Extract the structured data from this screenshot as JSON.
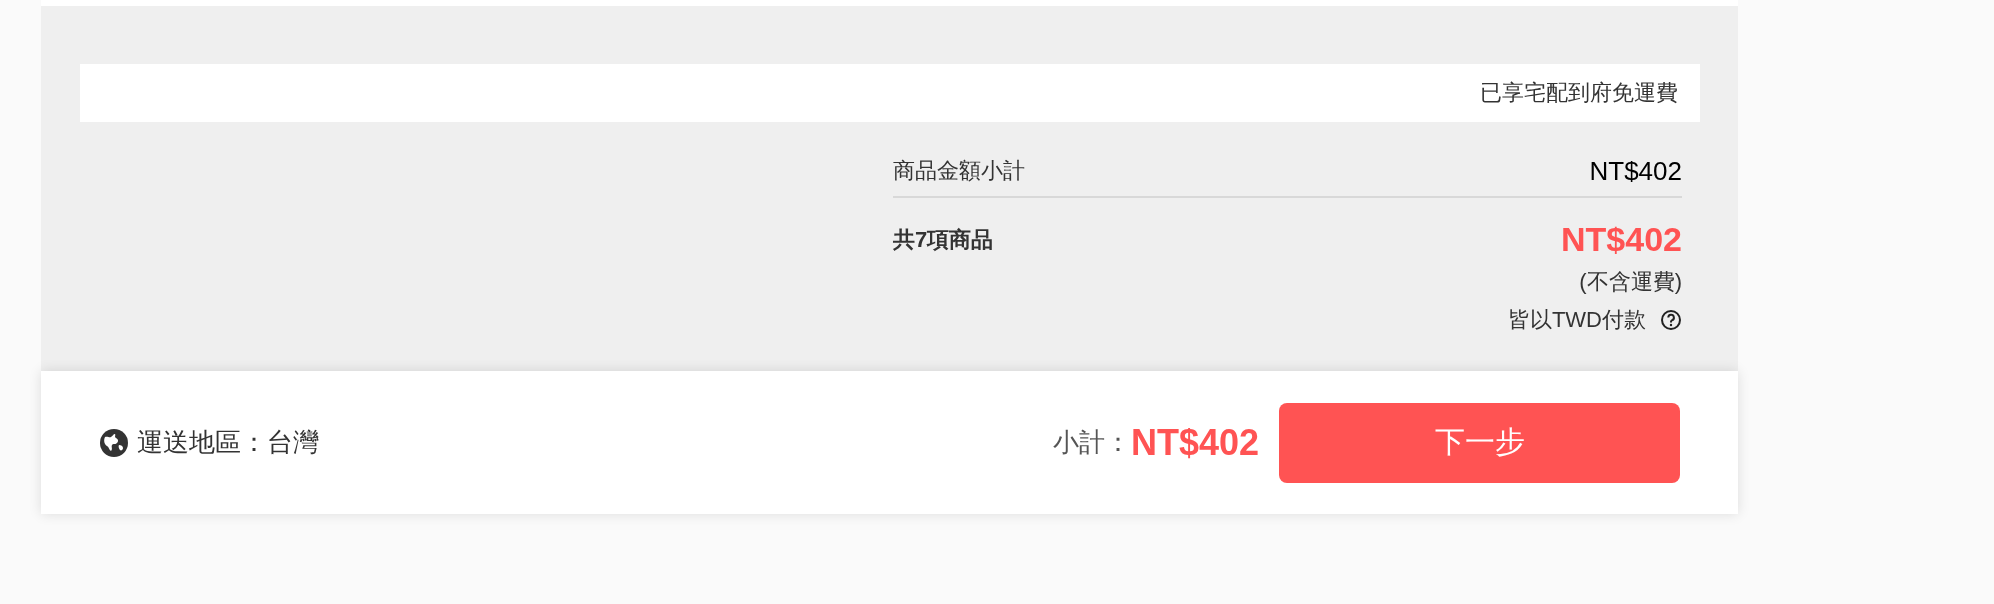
{
  "shipping_notice": "已享宅配到府免運費",
  "summary": {
    "subtotal_label": "商品金額小計",
    "subtotal_value": "NT$402",
    "total_label": "共7項商品",
    "total_value": "NT$402",
    "shipping_note": "(不含運費)",
    "currency_note": "皆以TWD付款"
  },
  "checkout_bar": {
    "region_label": "運送地區：台灣",
    "subtotal_label": "小計：",
    "subtotal_value": "NT$402",
    "next_button": "下一步"
  }
}
